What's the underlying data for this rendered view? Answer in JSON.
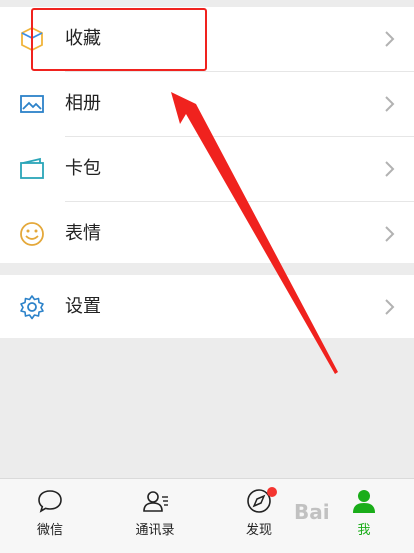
{
  "menu": {
    "group1": [
      {
        "label": "收藏",
        "icon": "favorites-cube-icon"
      },
      {
        "label": "相册",
        "icon": "album-icon"
      },
      {
        "label": "卡包",
        "icon": "card-pack-icon"
      },
      {
        "label": "表情",
        "icon": "sticker-smiley-icon"
      }
    ],
    "group2": [
      {
        "label": "设置",
        "icon": "settings-gear-icon"
      }
    ]
  },
  "tabbar": {
    "tabs": [
      {
        "label": "微信",
        "icon": "chat-bubble-icon",
        "active": false
      },
      {
        "label": "通讯录",
        "icon": "contacts-icon",
        "active": false
      },
      {
        "label": "发现",
        "icon": "compass-icon",
        "active": false,
        "badge": true
      },
      {
        "label": "我",
        "icon": "me-person-icon",
        "active": true
      }
    ]
  },
  "watermark": "Bai",
  "colors": {
    "accent_green": "#1aad19",
    "annotation_red": "#f0221e",
    "badge_red": "#f43530",
    "icon_blue": "#2c82c9"
  }
}
